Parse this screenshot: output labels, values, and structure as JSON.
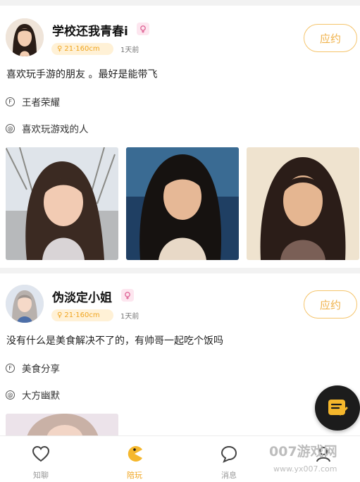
{
  "posts": [
    {
      "name": "学校还我青春i",
      "tag": "21·160cm",
      "time": "1天前",
      "button": "应约",
      "desc": "喜欢玩手游的朋友 。最好是能带飞",
      "game": "王者荣耀",
      "like": "喜欢玩游戏的人"
    },
    {
      "name": "伪淡定小姐",
      "tag": "21·160cm",
      "time": "1天前",
      "button": "应约",
      "desc": "没有什么是美食解决不了的，有帅哥一起吃个饭吗",
      "game": "美食分享",
      "like": "大方幽默"
    }
  ],
  "tabs": [
    {
      "label": "知聊",
      "icon": "heart-icon"
    },
    {
      "label": "陪玩",
      "icon": "pacman-icon"
    },
    {
      "label": "消息",
      "icon": "chat-bubble-icon"
    },
    {
      "label": "",
      "icon": "profile-icon"
    }
  ],
  "watermark": {
    "title": "007游戏网",
    "url": "www.yx007.com"
  },
  "colors": {
    "accent": "#f0a520",
    "badge_pink": "#e06a9a",
    "fab": "#1c1c1c"
  }
}
